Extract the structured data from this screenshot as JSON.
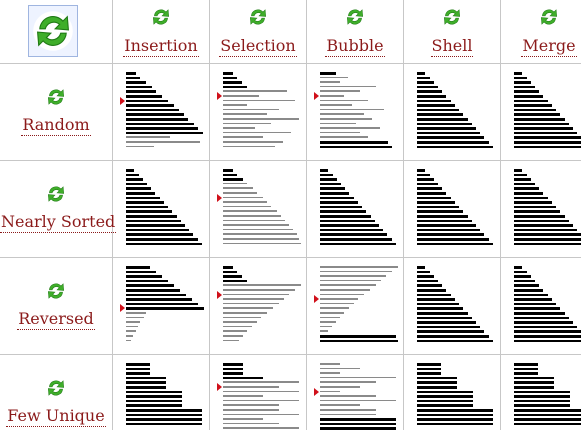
{
  "colors": {
    "label": "#8b1a1a",
    "grid": "#c7c7c7",
    "bar_sorted": "#000000",
    "bar_unsorted": "#8a8a8a",
    "pointer": "#d0101a",
    "icon_green": "#3fae2a"
  },
  "corner": {
    "icon": "refresh-all-icon"
  },
  "algorithms": [
    {
      "key": "insertion",
      "label": "Insertion",
      "icon": "refresh-icon"
    },
    {
      "key": "selection",
      "label": "Selection",
      "icon": "refresh-icon"
    },
    {
      "key": "bubble",
      "label": "Bubble",
      "icon": "refresh-icon"
    },
    {
      "key": "shell",
      "label": "Shell",
      "icon": "refresh-icon"
    },
    {
      "key": "merge",
      "label": "Merge",
      "icon": "refresh-icon"
    }
  ],
  "inputs": [
    {
      "key": "random",
      "label": "Random",
      "icon": "refresh-icon"
    },
    {
      "key": "nearly-sorted",
      "label": "Nearly Sorted",
      "icon": "refresh-icon"
    },
    {
      "key": "reversed",
      "label": "Reversed",
      "icon": "refresh-icon"
    },
    {
      "key": "few-unique",
      "label": "Few Unique",
      "icon": "refresh-icon"
    }
  ]
}
